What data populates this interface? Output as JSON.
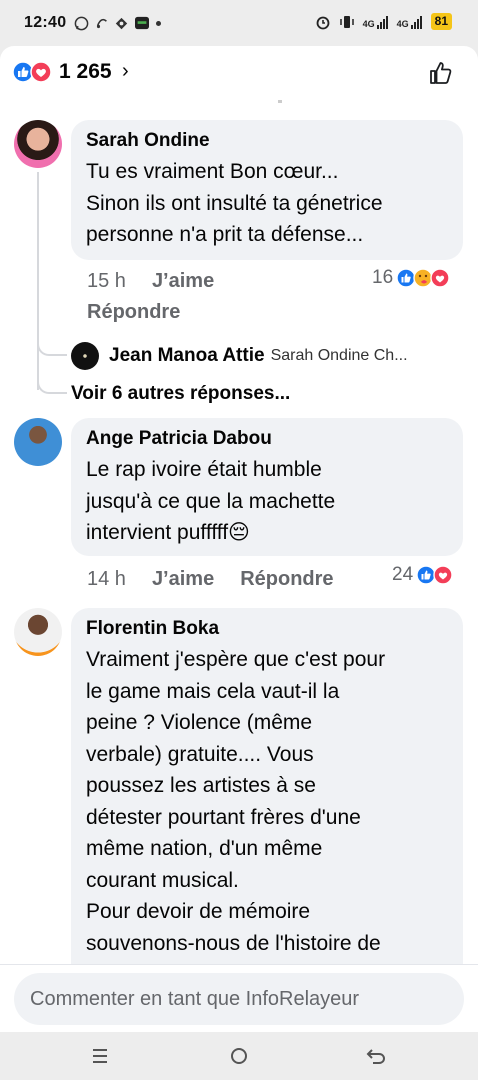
{
  "status_bar": {
    "time": "12:40",
    "battery": "81",
    "net1": "4G",
    "net2": "4G"
  },
  "header": {
    "reaction_count": "1 265",
    "chevron": "›",
    "reaction_icons": [
      "like-icon",
      "love-icon"
    ]
  },
  "comments": [
    {
      "author": "Sarah Ondine",
      "text": "Tu es vraiment Bon cœur...\nSinon ils ont insulté ta génetrice\npersonne n'a prit ta défense...",
      "time": "15 h",
      "like_label": "J’aime",
      "reply_label": "Répondre",
      "reaction_count": "16",
      "reaction_icons": [
        "like-icon",
        "care-icon",
        "love-icon"
      ],
      "reply_preview": {
        "author": "Jean Manoa Attie",
        "text": "Sarah Ondine Ch..."
      },
      "more_replies": "Voir 6 autres réponses..."
    },
    {
      "author": "Ange Patricia Dabou",
      "text": "Le rap ivoire était humble\njusqu'à ce que la machette\nintervient pufffff😔",
      "time": "14 h",
      "like_label": "J’aime",
      "reply_label": "Répondre",
      "reaction_count": "24",
      "reaction_icons": [
        "like-icon",
        "love-icon"
      ]
    },
    {
      "author": "Florentin Boka",
      "text": "Vraiment j'espère que c'est pour\nle game mais cela vaut-il la\npeine ? Violence (même\nverbale) gratuite.... Vous\npoussez les artistes à se\ndétester pourtant frères d'une\nmême nation, d'un même\ncourant musical.\nPour devoir de mémoire\nsouvenons-nous de l'histoire de"
    }
  ],
  "composer": {
    "placeholder": "Commenter en tant que InfoRelayeur"
  },
  "colors": {
    "like_blue": "#1877f2",
    "love_red": "#f33e58",
    "care_yellow": "#f7b125",
    "bubble_bg": "#f0f2f5",
    "meta_gray": "#65676b"
  }
}
